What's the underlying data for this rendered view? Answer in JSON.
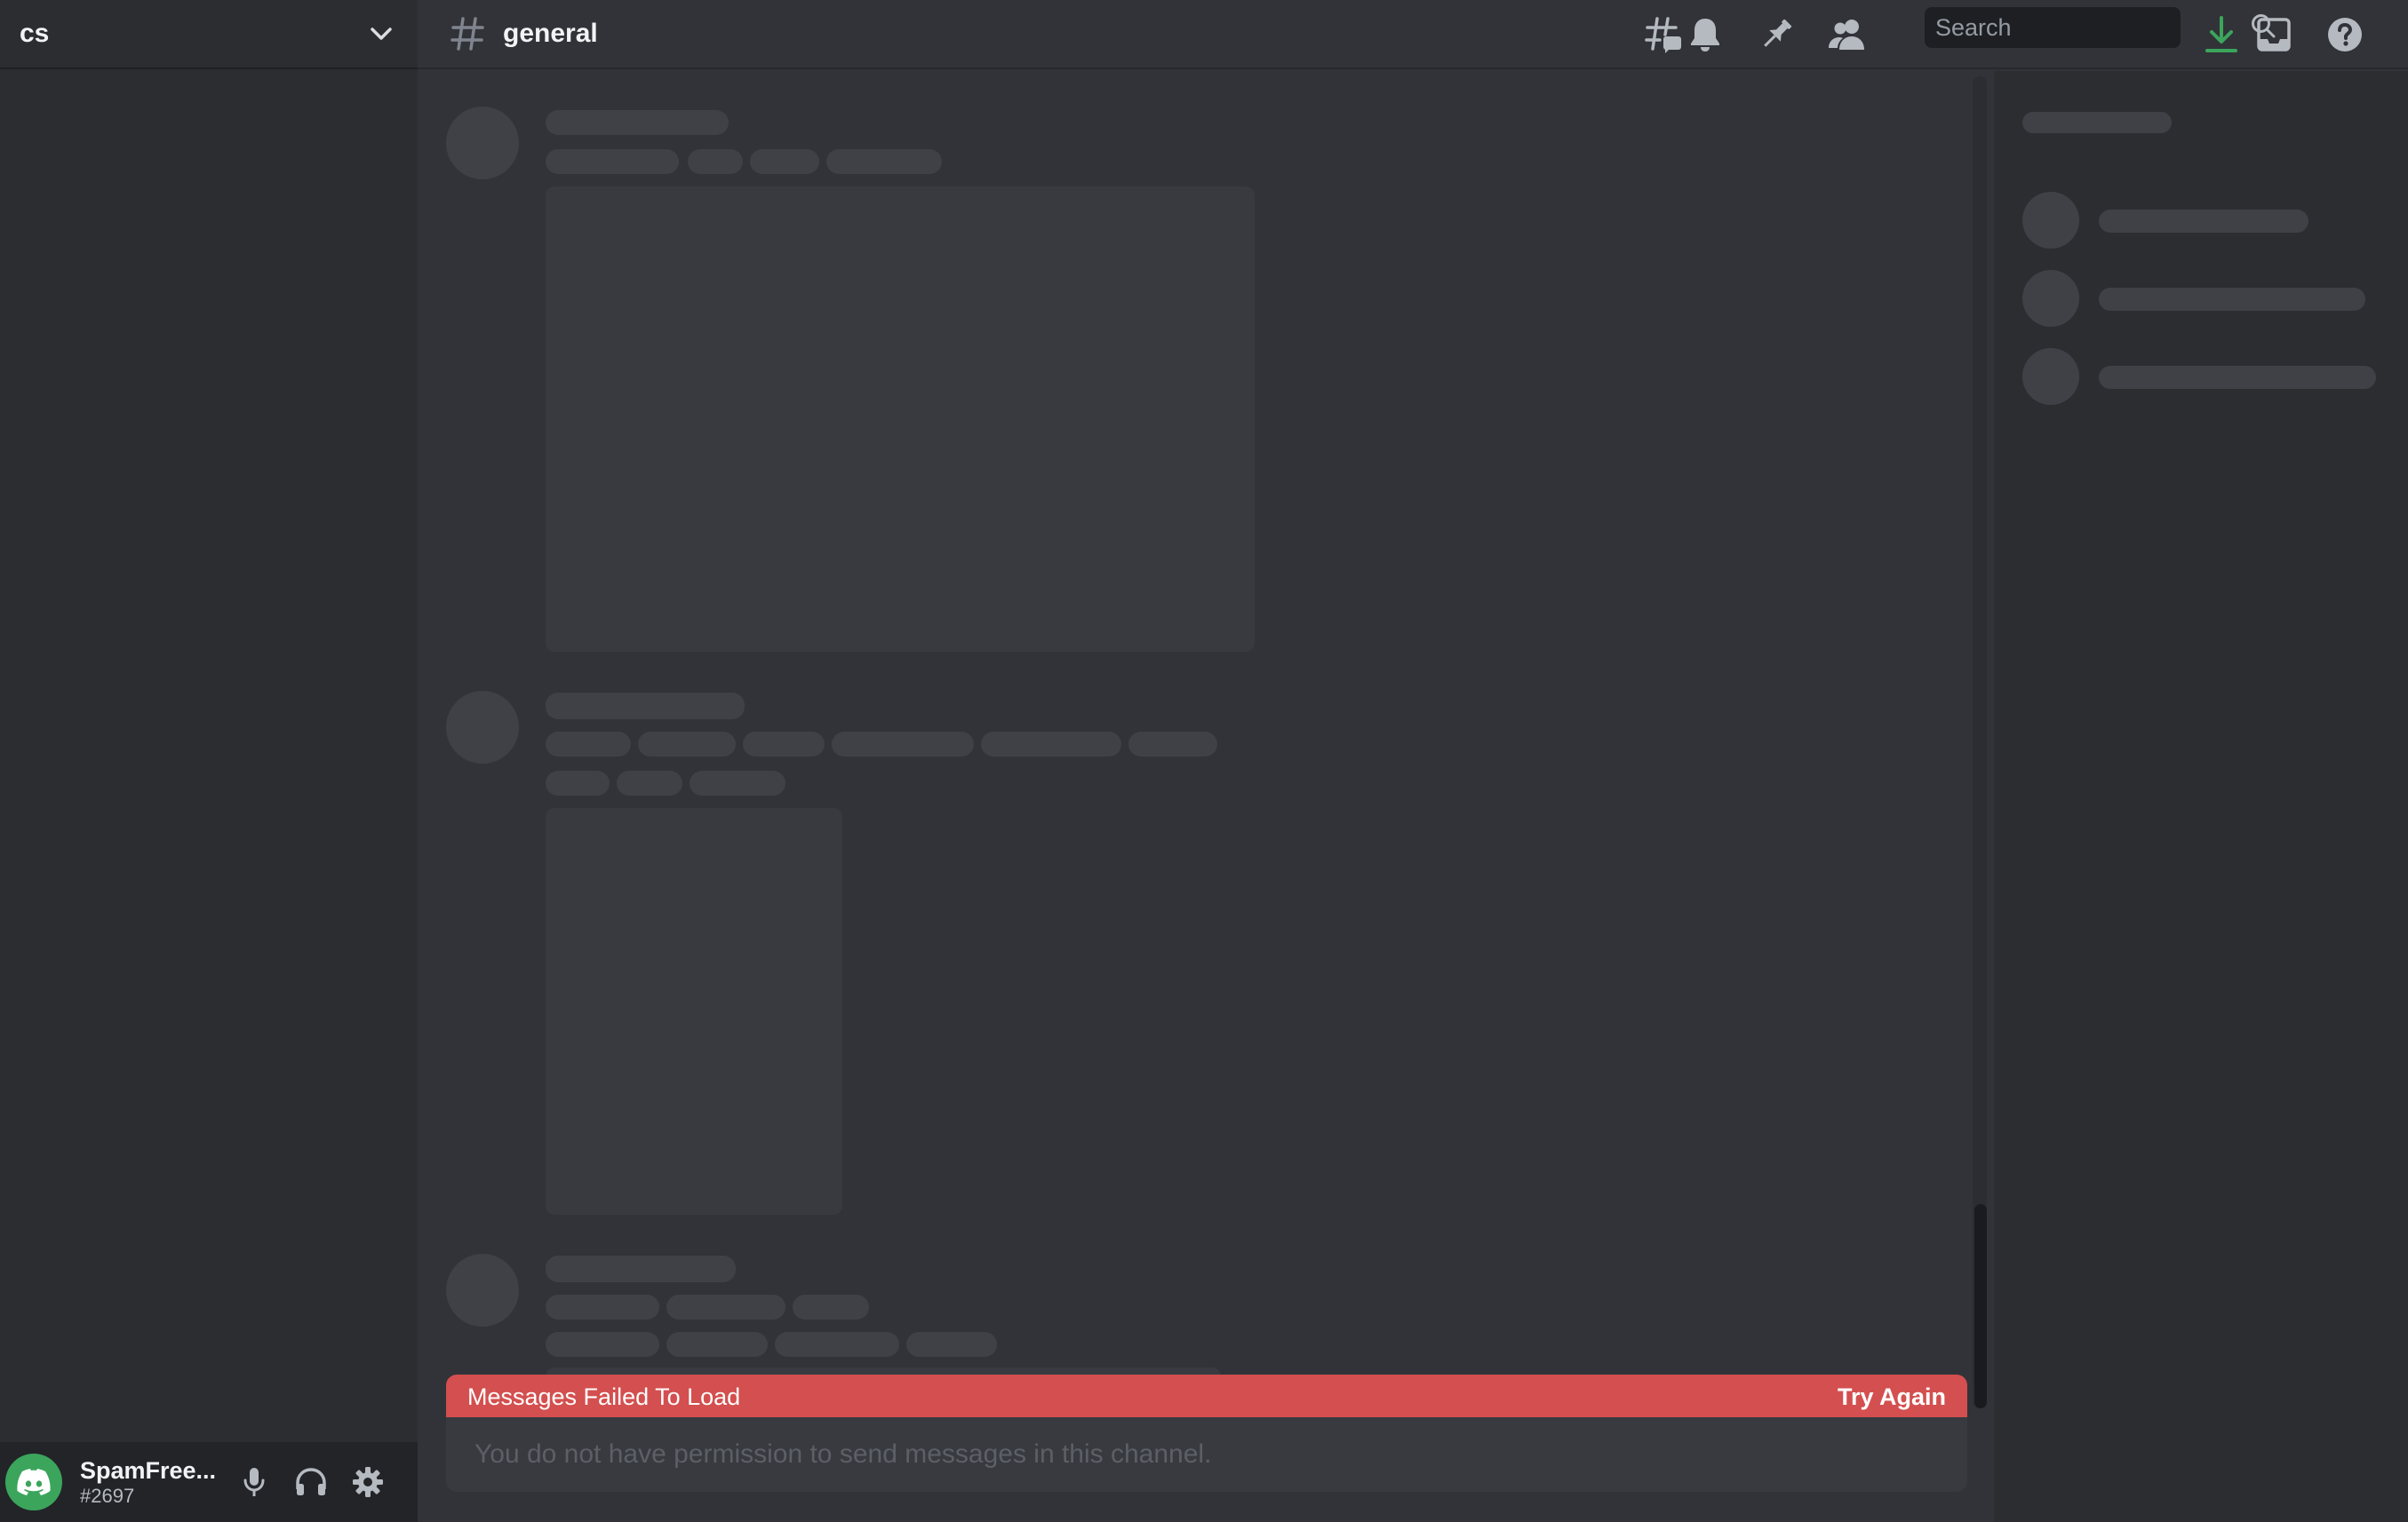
{
  "server": {
    "name": "cs"
  },
  "channel": {
    "name": "general"
  },
  "search": {
    "placeholder": "Search"
  },
  "user": {
    "name": "SpamFree...",
    "tag": "#2697"
  },
  "error": {
    "message": "Messages Failed To Load",
    "retry_label": "Try Again"
  },
  "composer": {
    "disabled_text": "You do not have permission to send messages in this channel."
  },
  "colors": {
    "error_red": "#d44f4f",
    "download_green": "#3ba55c",
    "avatar_green": "#3ba55c"
  },
  "icons": {
    "header": [
      "threads-icon",
      "bell-icon",
      "pin-icon",
      "members-icon",
      "search-icon",
      "download-icon",
      "inbox-icon",
      "help-icon"
    ],
    "user_panel": [
      "discord-logo-icon",
      "microphone-icon",
      "headphones-icon",
      "gear-icon"
    ]
  }
}
